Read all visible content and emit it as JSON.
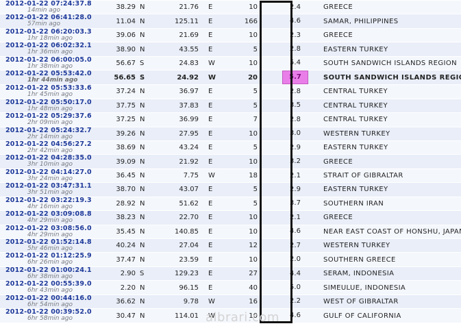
{
  "watermark": "albrari.com",
  "colors": {
    "link": "#1f3a9a",
    "highlight_magnitude": "#e97ee9",
    "frame": "#111111"
  },
  "quakes": [
    {
      "time": "2012-01-22  07:24:37.8",
      "ago": "14min ago",
      "lat": "38.29",
      "ns": "N",
      "lon": "21.76",
      "ew": "E",
      "depth": "10",
      "mag": "2.4",
      "region": "GREECE"
    },
    {
      "time": "2012-01-22  06:41:28.0",
      "ago": "57min ago",
      "lat": "11.04",
      "ns": "N",
      "lon": "125.11",
      "ew": "E",
      "depth": "166",
      "mag": "4.6",
      "region": "SAMAR, PHILIPPINES"
    },
    {
      "time": "2012-01-22  06:20:03.3",
      "ago": "1hr 18min ago",
      "lat": "39.06",
      "ns": "N",
      "lon": "21.69",
      "ew": "E",
      "depth": "10",
      "mag": "2.3",
      "region": "GREECE"
    },
    {
      "time": "2012-01-22  06:02:32.1",
      "ago": "1hr 36min ago",
      "lat": "38.90",
      "ns": "N",
      "lon": "43.55",
      "ew": "E",
      "depth": "5",
      "mag": "2.8",
      "region": "EASTERN TURKEY"
    },
    {
      "time": "2012-01-22  06:00:05.0",
      "ago": "1hr 38min ago",
      "lat": "56.67",
      "ns": "S",
      "lon": "24.83",
      "ew": "W",
      "depth": "10",
      "mag": "5.4",
      "region": "SOUTH SANDWICH ISLANDS REGION"
    },
    {
      "time": "2012-01-22  05:53:42.0",
      "ago": "1hr 44min ago",
      "lat": "56.65",
      "ns": "S",
      "lon": "24.92",
      "ew": "W",
      "depth": "20",
      "mag": "5.7",
      "region": "SOUTH SANDWICH ISLANDS REGION"
    },
    {
      "time": "2012-01-22  05:53:33.6",
      "ago": "1hr 45min ago",
      "lat": "37.24",
      "ns": "N",
      "lon": "36.97",
      "ew": "E",
      "depth": "5",
      "mag": "2.8",
      "region": "CENTRAL TURKEY"
    },
    {
      "time": "2012-01-22  05:50:17.0",
      "ago": "1hr 48min ago",
      "lat": "37.75",
      "ns": "N",
      "lon": "37.83",
      "ew": "E",
      "depth": "5",
      "mag": "3.5",
      "region": "CENTRAL TURKEY"
    },
    {
      "time": "2012-01-22  05:29:37.6",
      "ago": "2hr 09min ago",
      "lat": "37.25",
      "ns": "N",
      "lon": "36.99",
      "ew": "E",
      "depth": "7",
      "mag": "2.8",
      "region": "CENTRAL TURKEY"
    },
    {
      "time": "2012-01-22  05:24:32.7",
      "ago": "2hr 14min ago",
      "lat": "39.26",
      "ns": "N",
      "lon": "27.95",
      "ew": "E",
      "depth": "10",
      "mag": "3.0",
      "region": "WESTERN TURKEY"
    },
    {
      "time": "2012-01-22  04:56:27.2",
      "ago": "2hr 42min ago",
      "lat": "38.69",
      "ns": "N",
      "lon": "43.24",
      "ew": "E",
      "depth": "5",
      "mag": "2.9",
      "region": "EASTERN TURKEY"
    },
    {
      "time": "2012-01-22  04:28:35.0",
      "ago": "3hr 10min ago",
      "lat": "39.09",
      "ns": "N",
      "lon": "21.92",
      "ew": "E",
      "depth": "10",
      "mag": "3.2",
      "region": "GREECE"
    },
    {
      "time": "2012-01-22  04:14:27.0",
      "ago": "3hr 24min ago",
      "lat": "36.45",
      "ns": "N",
      "lon": "7.75",
      "ew": "W",
      "depth": "18",
      "mag": "2.1",
      "region": "STRAIT OF GIBRALTAR"
    },
    {
      "time": "2012-01-22  03:47:31.1",
      "ago": "3hr 51min ago",
      "lat": "38.70",
      "ns": "N",
      "lon": "43.07",
      "ew": "E",
      "depth": "5",
      "mag": "2.9",
      "region": "EASTERN TURKEY"
    },
    {
      "time": "2012-01-22  03:22:19.3",
      "ago": "4hr 16min ago",
      "lat": "28.92",
      "ns": "N",
      "lon": "51.62",
      "ew": "E",
      "depth": "5",
      "mag": "3.7",
      "region": "SOUTHERN IRAN"
    },
    {
      "time": "2012-01-22  03:09:08.8",
      "ago": "4hr 29min ago",
      "lat": "38.23",
      "ns": "N",
      "lon": "22.70",
      "ew": "E",
      "depth": "10",
      "mag": "2.1",
      "region": "GREECE"
    },
    {
      "time": "2012-01-22  03:08:56.0",
      "ago": "4hr 29min ago",
      "lat": "35.45",
      "ns": "N",
      "lon": "140.85",
      "ew": "E",
      "depth": "10",
      "mag": "4.6",
      "region": "NEAR EAST COAST OF HONSHU, JAPAN"
    },
    {
      "time": "2012-01-22  01:52:14.8",
      "ago": "5hr 46min ago",
      "lat": "40.24",
      "ns": "N",
      "lon": "27.04",
      "ew": "E",
      "depth": "12",
      "mag": "2.7",
      "region": "WESTERN TURKEY"
    },
    {
      "time": "2012-01-22  01:12:25.9",
      "ago": "6hr 26min ago",
      "lat": "37.47",
      "ns": "N",
      "lon": "23.59",
      "ew": "E",
      "depth": "10",
      "mag": "2.0",
      "region": "SOUTHERN GREECE"
    },
    {
      "time": "2012-01-22  01:00:24.1",
      "ago": "6hr 38min ago",
      "lat": "2.90",
      "ns": "S",
      "lon": "129.23",
      "ew": "E",
      "depth": "27",
      "mag": "4.4",
      "region": "SERAM, INDONESIA"
    },
    {
      "time": "2012-01-22  00:55:39.0",
      "ago": "6hr 43min ago",
      "lat": "2.20",
      "ns": "N",
      "lon": "96.15",
      "ew": "E",
      "depth": "40",
      "mag": "5.0",
      "region": "SIMEULUE, INDONESIA"
    },
    {
      "time": "2012-01-22  00:44:16.0",
      "ago": "6hr 54min ago",
      "lat": "36.62",
      "ns": "N",
      "lon": "9.78",
      "ew": "W",
      "depth": "16",
      "mag": "2.2",
      "region": "WEST OF GIBRALTAR"
    },
    {
      "time": "2012-01-22  00:39:52.0",
      "ago": "6hr 58min ago",
      "lat": "30.47",
      "ns": "N",
      "lon": "114.01",
      "ew": "W",
      "depth": "10",
      "mag": "4.6",
      "region": "GULF OF CALIFORNIA"
    }
  ]
}
